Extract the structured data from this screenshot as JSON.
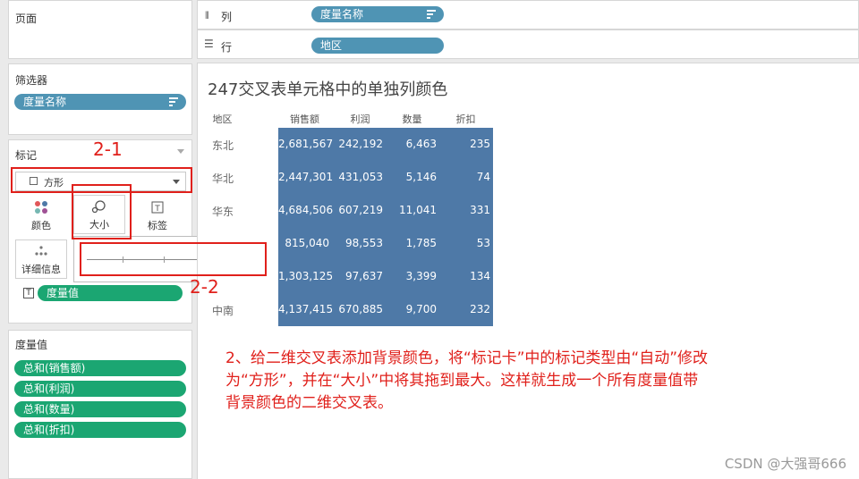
{
  "pages_card": {
    "title": "页面"
  },
  "columns_shelf": {
    "label": "列",
    "pill": "度量名称"
  },
  "rows_shelf": {
    "label": "行",
    "pill": "地区"
  },
  "filters_card": {
    "title": "筛选器",
    "pill": "度量名称"
  },
  "marks_card": {
    "title": "标记",
    "mark_type": "方形",
    "buttons": {
      "color": "颜色",
      "size": "大小",
      "label": "标签",
      "detail": "详细信息"
    },
    "measure_pill": "度量值",
    "size_slider_value": 1.0
  },
  "measure_values_card": {
    "title": "度量值",
    "pills": [
      "总和(销售额)",
      "总和(利润)",
      "总和(数量)",
      "总和(折扣)"
    ]
  },
  "view": {
    "title": "247交叉表单元格中的单独列颜色",
    "headers": [
      "地区",
      "销售额",
      "利润",
      "数量",
      "折扣"
    ],
    "rows": [
      {
        "region": "东北",
        "sales": "2,681,567",
        "profit": "242,192",
        "qty": "6,463",
        "discount": "235"
      },
      {
        "region": "华北",
        "sales": "2,447,301",
        "profit": "431,053",
        "qty": "5,146",
        "discount": "74"
      },
      {
        "region": "华东",
        "sales": "4,684,506",
        "profit": "607,219",
        "qty": "11,041",
        "discount": "331"
      },
      {
        "region": "",
        "sales": "815,040",
        "profit": "98,553",
        "qty": "1,785",
        "discount": "53"
      },
      {
        "region": "",
        "sales": "1,303,125",
        "profit": "97,637",
        "qty": "3,399",
        "discount": "134"
      },
      {
        "region": "中南",
        "sales": "4,137,415",
        "profit": "670,885",
        "qty": "9,700",
        "discount": "232"
      }
    ],
    "cell_color": "#4e79a7"
  },
  "annotations": {
    "label_1": "2-1",
    "label_2": "2-2",
    "text_line1": "2、给二维交叉表添加背景颜色，将“标记卡”中的标记类型由“自动”修改",
    "text_line2": "为“方形”，并在“大小”中将其拖到最大。这样就生成一个所有度量值带",
    "text_line3": "背景颜色的二维交叉表。",
    "color": "#e0201b"
  },
  "watermark": "CSDN @大强哥666"
}
